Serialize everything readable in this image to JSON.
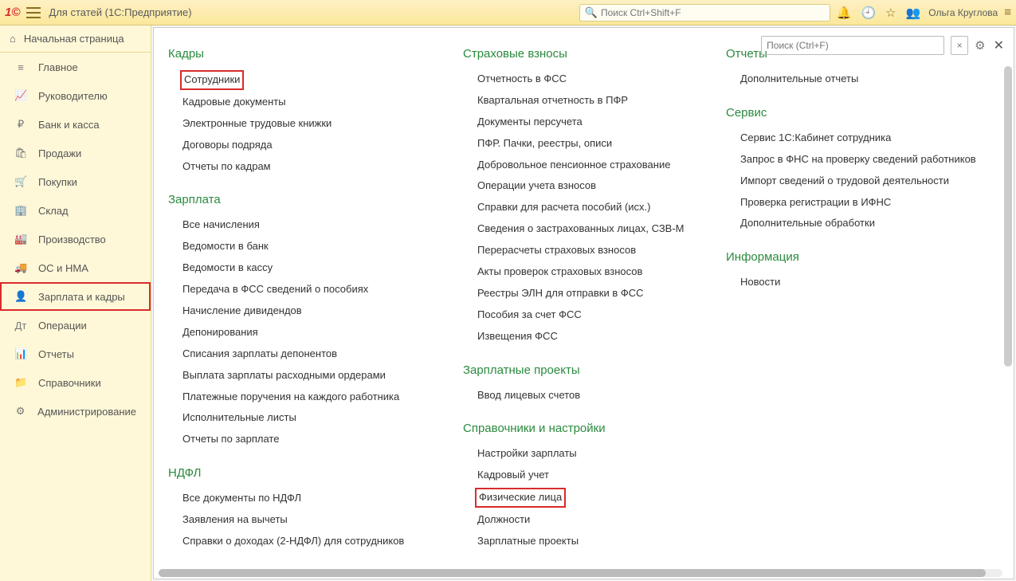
{
  "header": {
    "title": "Для статей  (1С:Предприятие)",
    "search_placeholder": "Поиск Ctrl+Shift+F",
    "user": "Ольга Круглова"
  },
  "sidebar": {
    "home": "Начальная страница",
    "items": [
      {
        "icon": "≡",
        "label": "Главное"
      },
      {
        "icon": "📈",
        "label": "Руководителю"
      },
      {
        "icon": "₽",
        "label": "Банк и касса"
      },
      {
        "icon": "🛍",
        "label": "Продажи"
      },
      {
        "icon": "🛒",
        "label": "Покупки"
      },
      {
        "icon": "🏢",
        "label": "Склад"
      },
      {
        "icon": "🏭",
        "label": "Производство"
      },
      {
        "icon": "🚚",
        "label": "ОС и НМА"
      },
      {
        "icon": "👤",
        "label": "Зарплата и кадры",
        "active": true
      },
      {
        "icon": "Дт",
        "label": "Операции"
      },
      {
        "icon": "📊",
        "label": "Отчеты"
      },
      {
        "icon": "📁",
        "label": "Справочники"
      },
      {
        "icon": "⚙",
        "label": "Администрирование"
      }
    ]
  },
  "panel": {
    "search_placeholder": "Поиск (Ctrl+F)",
    "col1": [
      {
        "title": "Кадры",
        "links": [
          {
            "t": "Сотрудники",
            "hl": true
          },
          {
            "t": "Кадровые документы"
          },
          {
            "t": "Электронные трудовые книжки"
          },
          {
            "t": "Договоры подряда"
          },
          {
            "t": "Отчеты по кадрам"
          }
        ]
      },
      {
        "title": "Зарплата",
        "links": [
          {
            "t": "Все начисления"
          },
          {
            "t": "Ведомости в банк"
          },
          {
            "t": "Ведомости в кассу"
          },
          {
            "t": "Передача в ФСС сведений о пособиях"
          },
          {
            "t": "Начисление дивидендов"
          },
          {
            "t": "Депонирования"
          },
          {
            "t": "Списания зарплаты депонентов"
          },
          {
            "t": "Выплата зарплаты расходными ордерами"
          },
          {
            "t": "Платежные поручения на каждого работника"
          },
          {
            "t": "Исполнительные листы"
          },
          {
            "t": "Отчеты по зарплате"
          }
        ]
      },
      {
        "title": "НДФЛ",
        "links": [
          {
            "t": "Все документы по НДФЛ"
          },
          {
            "t": "Заявления на вычеты"
          },
          {
            "t": "Справки о доходах (2-НДФЛ) для сотрудников"
          }
        ]
      }
    ],
    "col2": [
      {
        "title": "Страховые взносы",
        "links": [
          {
            "t": "Отчетность в ФСС"
          },
          {
            "t": "Квартальная отчетность в ПФР"
          },
          {
            "t": "Документы персучета"
          },
          {
            "t": "ПФР. Пачки, реестры, описи"
          },
          {
            "t": "Добровольное пенсионное страхование"
          },
          {
            "t": "Операции учета взносов"
          },
          {
            "t": "Справки для расчета пособий (исх.)"
          },
          {
            "t": "Сведения о застрахованных лицах, СЗВ-М"
          },
          {
            "t": "Перерасчеты страховых взносов"
          },
          {
            "t": "Акты проверок страховых взносов"
          },
          {
            "t": "Реестры ЭЛН для отправки в ФСС"
          },
          {
            "t": "Пособия за счет ФСС"
          },
          {
            "t": "Извещения ФСС"
          }
        ]
      },
      {
        "title": "Зарплатные проекты",
        "links": [
          {
            "t": "Ввод лицевых счетов"
          }
        ]
      },
      {
        "title": "Справочники и настройки",
        "links": [
          {
            "t": "Настройки зарплаты"
          },
          {
            "t": "Кадровый учет"
          },
          {
            "t": "Физические лица",
            "hl": true
          },
          {
            "t": "Должности"
          },
          {
            "t": "Зарплатные проекты"
          }
        ]
      }
    ],
    "col3": [
      {
        "title": "Отчеты",
        "links": [
          {
            "t": "Дополнительные отчеты"
          }
        ]
      },
      {
        "title": "Сервис",
        "links": [
          {
            "t": "Сервис 1С:Кабинет сотрудника"
          },
          {
            "t": "Запрос в ФНС на проверку сведений работников"
          },
          {
            "t": "Импорт сведений о трудовой деятельности"
          },
          {
            "t": "Проверка регистрации в ИФНС"
          },
          {
            "t": "Дополнительные обработки"
          }
        ]
      },
      {
        "title": "Информация",
        "links": [
          {
            "t": "Новости"
          }
        ]
      }
    ]
  }
}
